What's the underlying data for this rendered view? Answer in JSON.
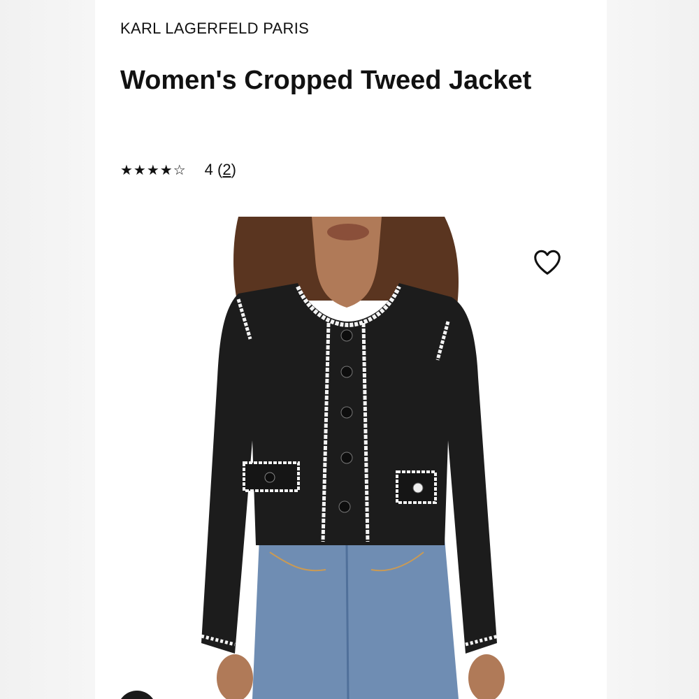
{
  "product": {
    "brand": "KARL LAGERFELD PARIS",
    "title": "Women's Cropped Tweed Jacket",
    "rating": {
      "stars_display": "★★★★☆",
      "value": "4",
      "review_count": "2",
      "stars_filled": 4,
      "stars_total": 5
    }
  },
  "image": {
    "subject": "product-photo-black-tweed-jacket",
    "wishlist_icon": "heart-icon"
  },
  "colors": {
    "jacket": "#1c1c1c",
    "trim": "#f4f4f4",
    "denim": "#6f8db3",
    "skin": "#b07a58",
    "hair": "#5a3520"
  }
}
